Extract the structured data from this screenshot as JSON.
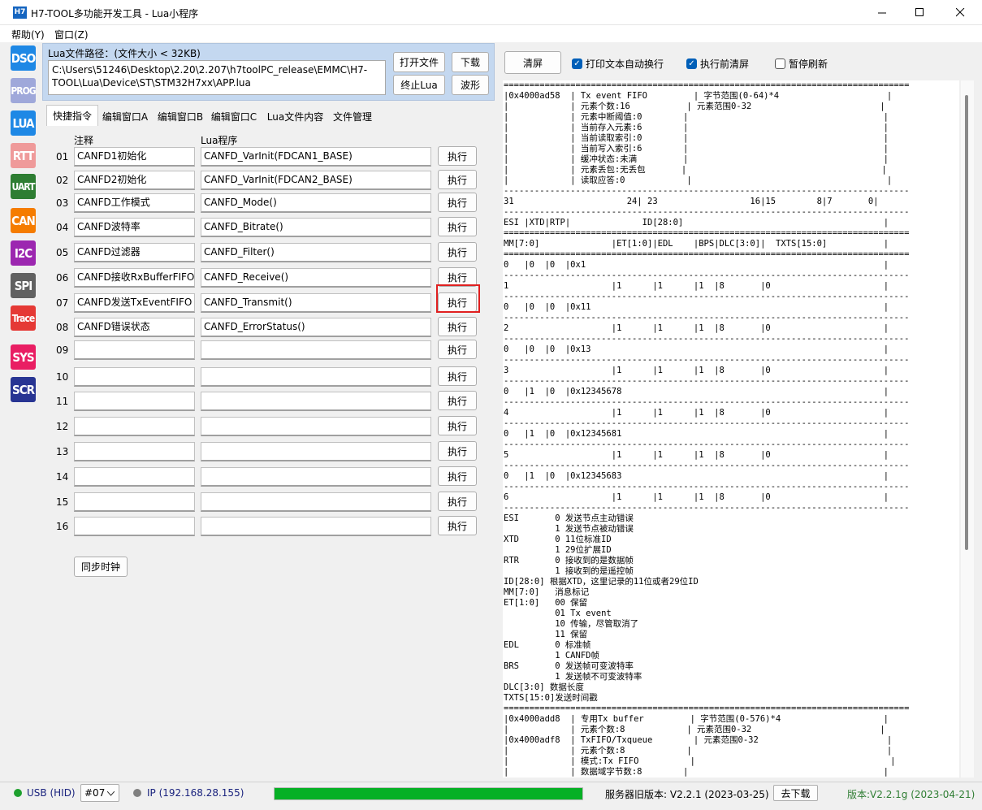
{
  "window": {
    "title": "H7-TOOL多功能开发工具 - Lua小程序",
    "icon_text": "H7"
  },
  "menu": [
    "帮助(Y)",
    "窗口(Z)"
  ],
  "toolbar": [
    {
      "label": "DSO",
      "color": "#1e88e5"
    },
    {
      "label": "PROG",
      "color": "#9fa8da"
    },
    {
      "label": "LUA",
      "color": "#1e88e5"
    },
    {
      "label": "RTT",
      "color": "#ef9a9a"
    },
    {
      "label": "UART",
      "color": "#2e7d32"
    },
    {
      "label": "CAN",
      "color": "#f57c00"
    },
    {
      "label": "I2C",
      "color": "#9c27b0"
    },
    {
      "label": "SPI",
      "color": "#616161"
    },
    {
      "label": "Trace",
      "color": "#e53935"
    },
    {
      "label": "SYS",
      "color": "#e91e63"
    },
    {
      "label": "SCR",
      "color": "#283593"
    }
  ],
  "file": {
    "path_label": "Lua文件路径：(文件大小 < 32KB)",
    "path_line1": "C:\\Users\\51246\\Desktop\\2.20\\2.207\\h7toolPC_release\\EMMC\\H7-",
    "path_line2": "TOOL\\Lua\\Device\\ST\\STM32H7xx\\APP.lua",
    "open_btn": "打开文件",
    "download_btn": "下载",
    "stop_btn": "终止Lua",
    "wave_btn": "波形"
  },
  "tabs": [
    "快捷指令",
    "编辑窗口A",
    "编辑窗口B",
    "编辑窗口C",
    "Lua文件内容",
    "文件管理"
  ],
  "commands": {
    "col_comment": "注释",
    "col_program": "Lua程序",
    "exec_label": "执行",
    "sync_btn": "同步时钟",
    "rows": [
      {
        "num": "01",
        "comment": "CANFD1初始化",
        "program": "CANFD_VarInit(FDCAN1_BASE)"
      },
      {
        "num": "02",
        "comment": "CANFD2初始化",
        "program": "CANFD_VarInit(FDCAN2_BASE)"
      },
      {
        "num": "03",
        "comment": "CANFD工作模式",
        "program": "CANFD_Mode()"
      },
      {
        "num": "04",
        "comment": "CANFD波特率",
        "program": "CANFD_Bitrate()"
      },
      {
        "num": "05",
        "comment": "CANFD过滤器",
        "program": "CANFD_Filter()"
      },
      {
        "num": "06",
        "comment": "CANFD接收RxBufferFIFO",
        "program": "CANFD_Receive()"
      },
      {
        "num": "07",
        "comment": "CANFD发送TxEventFIFO",
        "program": "CANFD_Transmit()"
      },
      {
        "num": "08",
        "comment": "CANFD错误状态",
        "program": "CANFD_ErrorStatus()"
      },
      {
        "num": "09",
        "comment": "",
        "program": ""
      },
      {
        "num": "10",
        "comment": "",
        "program": ""
      },
      {
        "num": "11",
        "comment": "",
        "program": ""
      },
      {
        "num": "12",
        "comment": "",
        "program": ""
      },
      {
        "num": "13",
        "comment": "",
        "program": ""
      },
      {
        "num": "14",
        "comment": "",
        "program": ""
      },
      {
        "num": "15",
        "comment": "",
        "program": ""
      },
      {
        "num": "16",
        "comment": "",
        "program": ""
      }
    ]
  },
  "right": {
    "clear_btn": "清屏",
    "wrap_label": "打印文本自动换行",
    "wrap_checked": true,
    "clear_before_label": "执行前清屏",
    "clear_before_checked": true,
    "pause_label": "暂停刷新",
    "pause_checked": false
  },
  "console_lines": [
    "===============================================================================",
    "|0x4000ad58  | Tx event FIFO         | 字节范围(0-64)*4                     |",
    "|            | 元素个数:16           | 元素范围0-32                         |",
    "|            | 元素中断阈值:0        |                                      |",
    "|            | 当前存入元素:6        |                                      |",
    "|            | 当前读取索引:0        |                                      |",
    "|            | 当前写入索引:6        |                                      |",
    "|            | 缓冲状态:未满         |                                      |",
    "|            | 元素丢包:无丢包       |                                      |",
    "|            | 读取应答:0            |                                      |",
    "-------------------------------------------------------------------------------",
    "31                      24| 23                  16|15        8|7       0|",
    "-------------------------------------------------------------------------------",
    "ESI |XTD|RTP|              ID[28:0]                                       |",
    "===============================================================================",
    "MM[7:0]              |ET[1:0]|EDL    |BPS|DLC[3:0]|  TXTS[15:0]           |",
    "===============================================================================",
    "0   |0  |0  |0x1                                                          |",
    "-------------------------------------------------------------------------------",
    "1                    |1      |1      |1  |8       |0                      |",
    "-------------------------------------------------------------------------------",
    "0   |0  |0  |0x11                                                         |",
    "-------------------------------------------------------------------------------",
    "2                    |1      |1      |1  |8       |0                      |",
    "-------------------------------------------------------------------------------",
    "0   |0  |0  |0x13                                                         |",
    "-------------------------------------------------------------------------------",
    "3                    |1      |1      |1  |8       |0                      |",
    "-------------------------------------------------------------------------------",
    "0   |1  |0  |0x12345678                                                   |",
    "-------------------------------------------------------------------------------",
    "4                    |1      |1      |1  |8       |0                      |",
    "-------------------------------------------------------------------------------",
    "0   |1  |0  |0x12345681                                                   |",
    "-------------------------------------------------------------------------------",
    "5                    |1      |1      |1  |8       |0                      |",
    "-------------------------------------------------------------------------------",
    "0   |1  |0  |0x12345683                                                   |",
    "-------------------------------------------------------------------------------",
    "6                    |1      |1      |1  |8       |0                      |",
    "-------------------------------------------------------------------------------",
    "ESI       0 发送节点主动错误",
    "          1 发送节点被动错误",
    "XTD       0 11位标准ID",
    "          1 29位扩展ID",
    "RTR       0 接收到的是数据帧",
    "          1 接收到的是遥控帧",
    "ID[28:0] 根据XTD，这里记录的11位或者29位ID",
    "MM[7:0]   消息标记",
    "ET[1:0]   00 保留",
    "          01 Tx event",
    "          10 传输，尽管取消了",
    "          11 保留",
    "EDL       0 标准帧",
    "          1 CANFD帧",
    "BRS       0 发送帧可变波特率",
    "          1 发送帧不可变波特率",
    "DLC[3:0] 数据长度",
    "TXTS[15:0]发送时间戳",
    "===============================================================================",
    "|0x4000add8  | 专用Tx buffer         | 字节范围(0-576)*4                    |",
    "|            | 元素个数:8            | 元素范围0-32                         |",
    "|0x4000adf8  | TxFIFO/Txqueue        | 元素范围0-32                         |",
    "|            | 元素个数:8            |                                      |",
    "|            | 模式:Tx FIFO          |                                      |",
    "|            | 数据域字节数:8        |                                      |"
  ],
  "status": {
    "usb": "USB (HID)",
    "device": "#07",
    "ip": "IP (192.168.28.155)",
    "progress": 1.0,
    "server_version": "服务器旧版本: V2.2.1 (2023-03-25)",
    "download_btn": "去下载",
    "version": "版本:V2.2.1g (2023-04-21)"
  }
}
